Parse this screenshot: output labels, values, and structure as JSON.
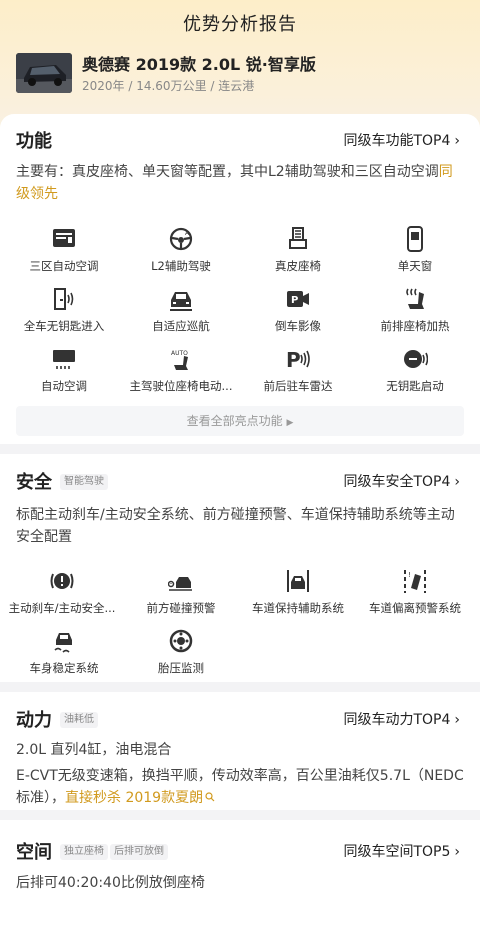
{
  "header": {
    "title": "优势分析报告",
    "car_name": "奥德赛 2019款 2.0L 锐·智享版",
    "car_meta": "2020年 / 14.60万公里 / 连云港"
  },
  "features_section": {
    "title": "功能",
    "top_link": "同级车功能TOP4",
    "desc_prefix": "主要有：真皮座椅、单天窗等配置，其中L2辅助驾驶和三区自动空调",
    "desc_highlight": "同级领先",
    "items": [
      {
        "label": "三区自动空调",
        "icon": "climate-control-icon"
      },
      {
        "label": "L2辅助驾驶",
        "icon": "steering-wheel-icon"
      },
      {
        "label": "真皮座椅",
        "icon": "leather-seat-icon"
      },
      {
        "label": "单天窗",
        "icon": "sunroof-icon"
      },
      {
        "label": "全车无钥匙进入",
        "icon": "keyless-entry-icon"
      },
      {
        "label": "自适应巡航",
        "icon": "adaptive-cruise-icon"
      },
      {
        "label": "倒车影像",
        "icon": "reverse-camera-icon"
      },
      {
        "label": "前排座椅加热",
        "icon": "seat-heating-icon"
      },
      {
        "label": "自动空调",
        "icon": "auto-ac-icon"
      },
      {
        "label": "主驾驶位座椅电动...",
        "icon": "power-seat-icon"
      },
      {
        "label": "前后驻车雷达",
        "icon": "parking-radar-icon"
      },
      {
        "label": "无钥匙启动",
        "icon": "start-button-icon"
      }
    ],
    "view_all": "查看全部亮点功能"
  },
  "safety_section": {
    "title": "安全",
    "tag": "智能驾驶",
    "top_link": "同级车安全TOP4",
    "desc": "标配主动刹车/主动安全系统、前方碰撞预警、车道保持辅助系统等主动安全配置",
    "items": [
      {
        "label": "主动刹车/主动安全...",
        "icon": "brake-warning-icon"
      },
      {
        "label": "前方碰撞预警",
        "icon": "collision-warning-icon"
      },
      {
        "label": "车道保持辅助系统",
        "icon": "lane-keep-icon"
      },
      {
        "label": "车道偏离预警系统",
        "icon": "lane-departure-icon"
      },
      {
        "label": "车身稳定系统",
        "icon": "stability-control-icon"
      },
      {
        "label": "胎压监测",
        "icon": "tire-pressure-icon"
      }
    ]
  },
  "power_section": {
    "title": "动力",
    "tag": "油耗低",
    "top_link": "同级车动力TOP4",
    "line1": "2.0L 直列4缸，油电混合",
    "line2_prefix": "E-CVT无级变速箱，换挡平顺，传动效率高，百公里油耗仅5.7L（NEDC标准），",
    "line2_highlight": "直接秒杀 2019款夏朗"
  },
  "space_section": {
    "title": "空间",
    "tags": [
      "独立座椅",
      "后排可放倒"
    ],
    "top_link": "同级车空间TOP5",
    "desc": "后排可40:20:40比例放倒座椅"
  },
  "colors": {
    "accent": "#d19a1e",
    "hero_top": "#fdeec9",
    "icon": "#333333"
  }
}
